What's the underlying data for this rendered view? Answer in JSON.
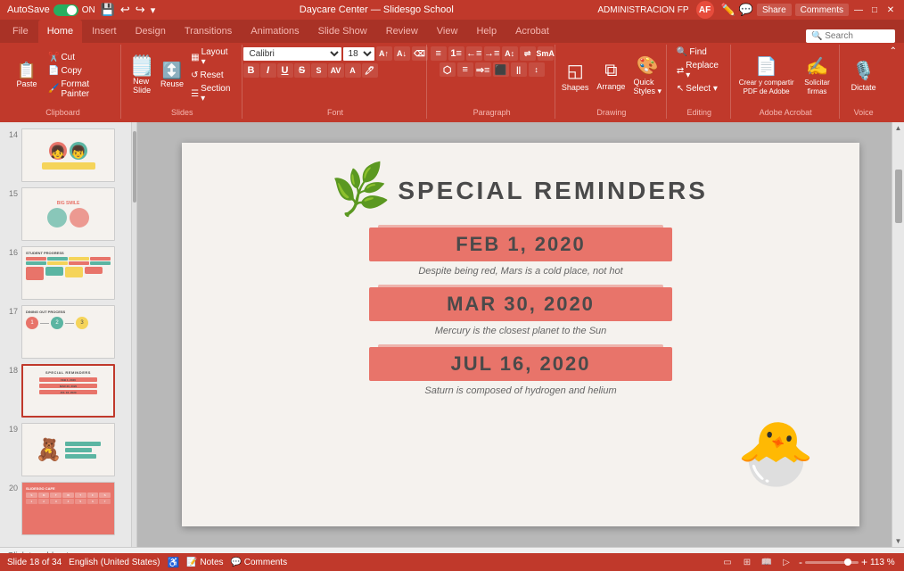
{
  "titlebar": {
    "autosave_label": "AutoSave",
    "autosave_state": "ON",
    "doc_title": "Daycare Center — Slidesgo School",
    "user_label": "ADMINISTRACION FP",
    "user_initials": "AF",
    "window_controls": [
      "minimize",
      "maximize",
      "close"
    ]
  },
  "ribbon": {
    "tabs": [
      "File",
      "Home",
      "Insert",
      "Design",
      "Transitions",
      "Animations",
      "Slide Show",
      "Review",
      "View",
      "Help",
      "Acrobat"
    ],
    "active_tab": "Home",
    "groups": {
      "clipboard": {
        "label": "Clipboard",
        "buttons": [
          "Paste",
          "Cut",
          "Copy",
          "Format Painter"
        ]
      },
      "slides": {
        "label": "Slides",
        "buttons": [
          "New Slide",
          "Layout",
          "Reset",
          "Section"
        ]
      },
      "font": {
        "label": "Font",
        "font_name": "Calibri",
        "font_size": "18",
        "bold": "B",
        "italic": "I",
        "underline": "U",
        "strikethrough": "S"
      },
      "paragraph": {
        "label": "Paragraph"
      },
      "drawing": {
        "label": "Drawing",
        "buttons": [
          "Shapes",
          "Arrange",
          "Quick Styles"
        ]
      },
      "editing": {
        "label": "Editing",
        "buttons": [
          "Find",
          "Replace",
          "Select"
        ]
      },
      "adobe": {
        "label": "Adobe Acrobat",
        "buttons": [
          "Crear y compartir PDF de Adobe",
          "Solicitar firmas"
        ]
      },
      "voice": {
        "label": "Voice",
        "buttons": [
          "Dictate"
        ]
      }
    }
  },
  "toolbar": {
    "share_label": "Share",
    "comments_label": "Comments"
  },
  "slides": [
    {
      "num": "14",
      "type": "people"
    },
    {
      "num": "15",
      "type": "blobs"
    },
    {
      "num": "16",
      "type": "table",
      "label": "STUDENT PROGRESS"
    },
    {
      "num": "17",
      "type": "dining",
      "label": "DINING OUT PROCESS"
    },
    {
      "num": "18",
      "type": "reminders",
      "active": true
    },
    {
      "num": "19",
      "type": "toys"
    },
    {
      "num": "20",
      "type": "calendar"
    }
  ],
  "slide": {
    "title": "SPECIAL REMINDERS",
    "reminders": [
      {
        "date": "FEB 1, 2020",
        "description": "Despite being red, Mars is a cold place, not hot"
      },
      {
        "date": "MAR 30, 2020",
        "description": "Mercury is the closest planet to the Sun"
      },
      {
        "date": "JUL 16, 2020",
        "description": "Saturn is composed of hydrogen and helium"
      }
    ]
  },
  "statusbar": {
    "slide_info": "Slide 18 of 34",
    "language": "English (United States)",
    "notes_label": "Click to add notes",
    "zoom_level": "113 %",
    "view_modes": [
      "normal",
      "slide-sorter",
      "reading",
      "presentation"
    ]
  }
}
